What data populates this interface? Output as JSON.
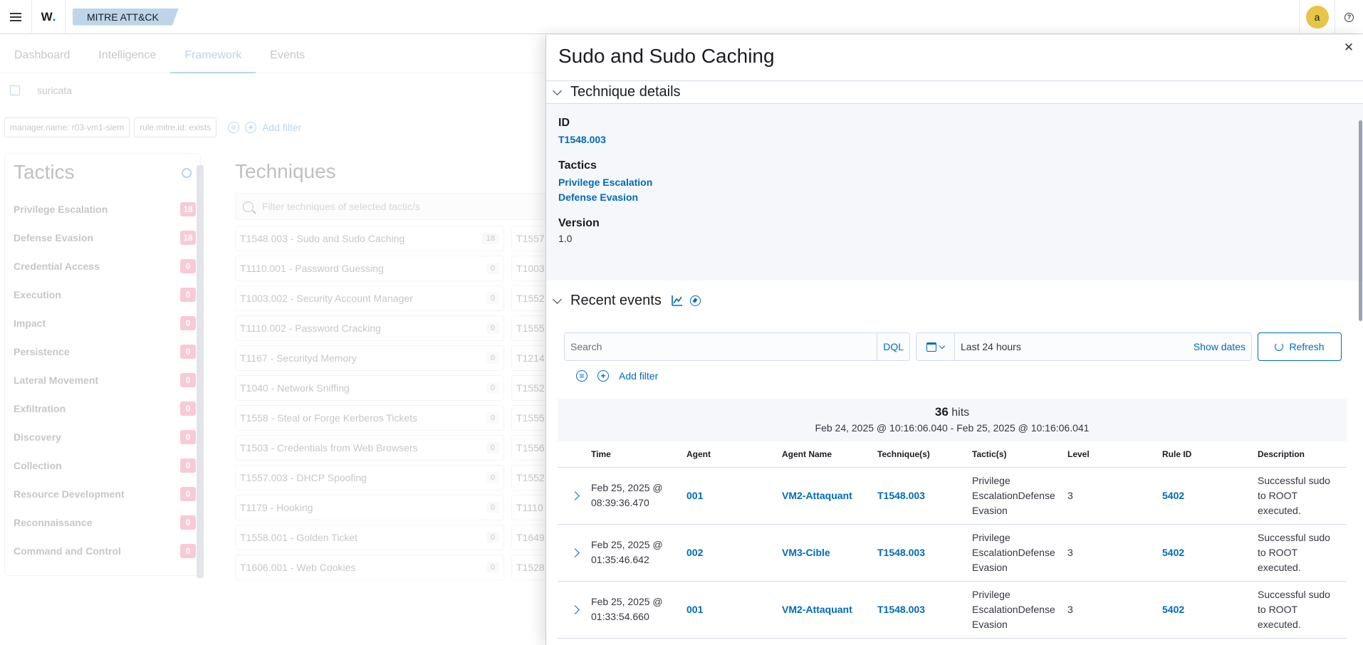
{
  "header": {
    "logo_text": "W",
    "logo_dot": ".",
    "breadcrumb": "MITRE ATT&CK",
    "avatar_initial": "a",
    "help_glyph": "?"
  },
  "background": {
    "tabs": [
      "Dashboard",
      "Intelligence",
      "Framework",
      "Events"
    ],
    "index_pattern": "suricata",
    "filter_pills": [
      "manager.name: r03-vm1-siem",
      "rule.mitre.id: exists"
    ],
    "add_filter": "Add filter",
    "tactics_title": "Tactics",
    "tactics": [
      {
        "name": "Privilege Escalation",
        "count": "18"
      },
      {
        "name": "Defense Evasion",
        "count": "18"
      },
      {
        "name": "Credential Access",
        "count": "0"
      },
      {
        "name": "Execution",
        "count": "0"
      },
      {
        "name": "Impact",
        "count": "0"
      },
      {
        "name": "Persistence",
        "count": "0"
      },
      {
        "name": "Lateral Movement",
        "count": "0"
      },
      {
        "name": "Exfiltration",
        "count": "0"
      },
      {
        "name": "Discovery",
        "count": "0"
      },
      {
        "name": "Collection",
        "count": "0"
      },
      {
        "name": "Resource Development",
        "count": "0"
      },
      {
        "name": "Reconnaissance",
        "count": "0"
      },
      {
        "name": "Command and Control",
        "count": "0"
      }
    ],
    "techniques_title": "Techniques",
    "techniques_search_placeholder": "Filter techniques of selected tactic/s",
    "techniques_col1": [
      {
        "label": "T1548.003 - Sudo and Sudo Caching",
        "count": "18"
      },
      {
        "label": "T1110.001 - Password Guessing",
        "count": "0"
      },
      {
        "label": "T1003.002 - Security Account Manager",
        "count": "0"
      },
      {
        "label": "T1110.002 - Password Cracking",
        "count": "0"
      },
      {
        "label": "T1167 - Securityd Memory",
        "count": "0"
      },
      {
        "label": "T1040 - Network Sniffing",
        "count": "0"
      },
      {
        "label": "T1558 - Steal or Forge Kerberos Tickets",
        "count": "0"
      },
      {
        "label": "T1503 - Credentials from Web Browsers",
        "count": "0"
      },
      {
        "label": "T1557.003 - DHCP Spoofing",
        "count": "0"
      },
      {
        "label": "T1179 - Hooking",
        "count": "0"
      },
      {
        "label": "T1558.001 - Golden Ticket",
        "count": "0"
      },
      {
        "label": "T1606.001 - Web Cookies",
        "count": "0"
      }
    ],
    "techniques_col2": [
      "T1557",
      "T1003",
      "T1552",
      "T1555",
      "T1214",
      "T1552",
      "T1555",
      "T1556",
      "T1552",
      "T1110",
      "T1649",
      "T1528"
    ]
  },
  "flyout": {
    "title": "Sudo and Sudo Caching",
    "details_title": "Technique details",
    "id_label": "ID",
    "id_value": "T1548.003",
    "tactics_label": "Tactics",
    "tactics": [
      "Privilege Escalation",
      "Defense Evasion"
    ],
    "version_label": "Version",
    "version_value": "1.0",
    "recent_title": "Recent events",
    "search_placeholder": "Search",
    "dql_label": "DQL",
    "date_range": "Last 24 hours",
    "show_dates": "Show dates",
    "refresh_label": "Refresh",
    "add_filter": "Add filter",
    "hits_count": "36",
    "hits_word": "hits",
    "hits_range": "Feb 24, 2025 @ 10:16:06.040 - Feb 25, 2025 @ 10:16:06.041",
    "columns": [
      "Time",
      "Agent",
      "Agent Name",
      "Technique(s)",
      "Tactic(s)",
      "Level",
      "Rule ID",
      "Description"
    ],
    "rows": [
      {
        "time": "Feb 25, 2025 @ 08:39:36.470",
        "agent": "001",
        "agent_name": "VM2-Attaquant",
        "technique": "T1548.003",
        "tactics": "Privilege EscalationDefense Evasion",
        "level": "3",
        "rule_id": "5402",
        "description": "Successful sudo to ROOT executed."
      },
      {
        "time": "Feb 25, 2025 @ 01:35:46.642",
        "agent": "002",
        "agent_name": "VM3-Cible",
        "technique": "T1548.003",
        "tactics": "Privilege EscalationDefense Evasion",
        "level": "3",
        "rule_id": "5402",
        "description": "Successful sudo to ROOT executed."
      },
      {
        "time": "Feb 25, 2025 @ 01:33:54.660",
        "agent": "001",
        "agent_name": "VM2-Attaquant",
        "technique": "T1548.003",
        "tactics": "Privilege EscalationDefense Evasion",
        "level": "3",
        "rule_id": "5402",
        "description": "Successful sudo to ROOT executed."
      }
    ]
  },
  "colors": {
    "accent": "#006bb8",
    "breadcrumb_bg": "#bcd5ea",
    "badge": "#e7466f",
    "avatar": "#e7c547"
  }
}
